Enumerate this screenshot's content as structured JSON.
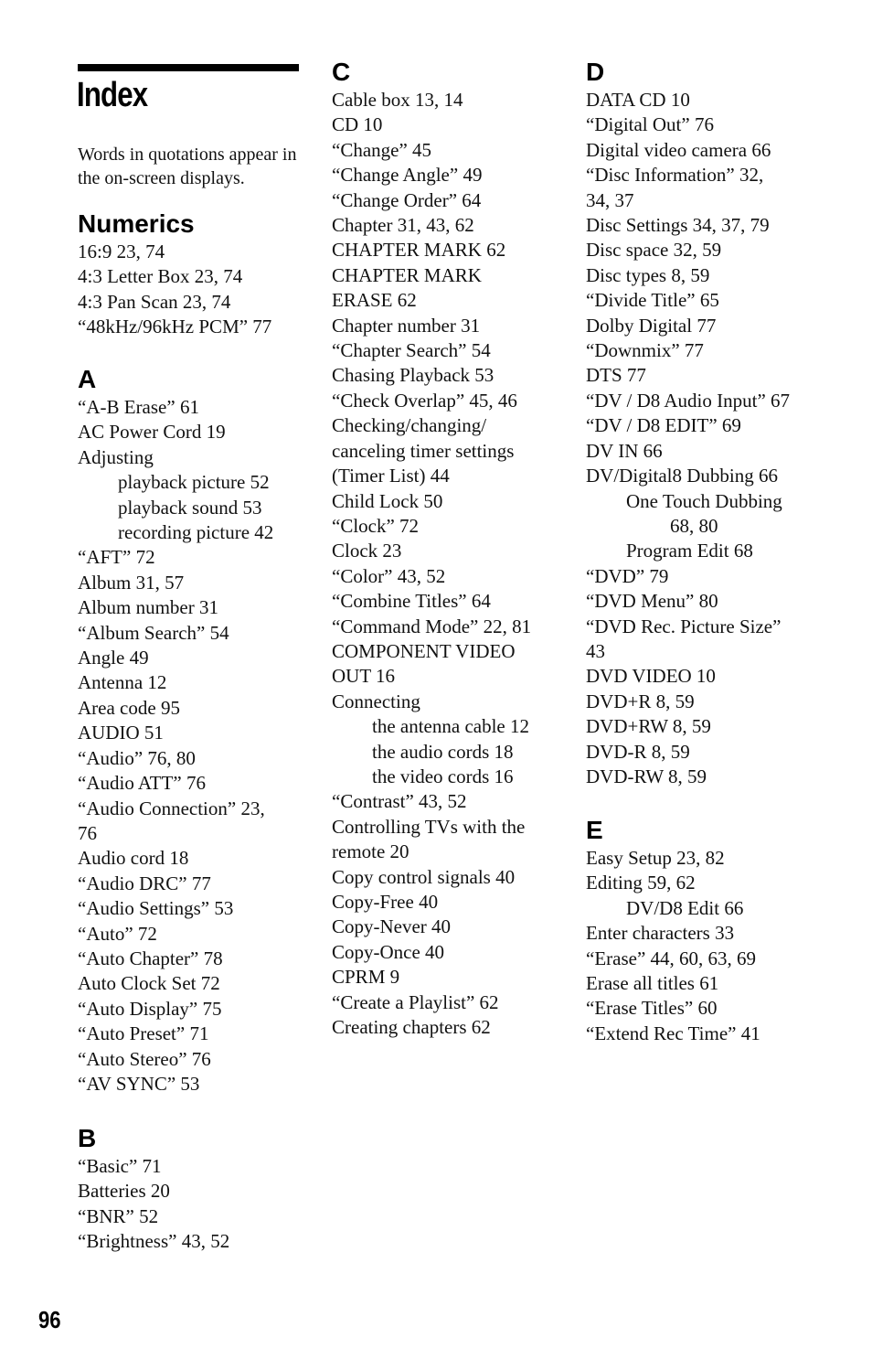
{
  "page": {
    "title": "Index",
    "note": "Words in quotations appear in the on-screen displays.",
    "page_number": "96"
  },
  "sections": {
    "numerics": {
      "heading": "Numerics",
      "entries": [
        {
          "text": "16:9 23, 74",
          "level": 0
        },
        {
          "text": "4:3 Letter Box 23, 74",
          "level": 0
        },
        {
          "text": "4:3 Pan Scan 23, 74",
          "level": 0
        },
        {
          "text": "“48kHz/96kHz PCM” 77",
          "level": 0
        }
      ]
    },
    "a": {
      "heading": "A",
      "entries": [
        {
          "text": "“A-B Erase” 61",
          "level": 0
        },
        {
          "text": "AC Power Cord 19",
          "level": 0
        },
        {
          "text": "Adjusting",
          "level": 0
        },
        {
          "text": "playback picture 52",
          "level": 1
        },
        {
          "text": "playback sound 53",
          "level": 1
        },
        {
          "text": "recording picture 42",
          "level": 1
        },
        {
          "text": "“AFT” 72",
          "level": 0
        },
        {
          "text": "Album 31, 57",
          "level": 0
        },
        {
          "text": "Album number 31",
          "level": 0
        },
        {
          "text": "“Album Search” 54",
          "level": 0
        },
        {
          "text": "Angle 49",
          "level": 0
        },
        {
          "text": "Antenna 12",
          "level": 0
        },
        {
          "text": "Area code 95",
          "level": 0
        },
        {
          "text": "AUDIO 51",
          "level": 0
        },
        {
          "text": "“Audio” 76, 80",
          "level": 0
        },
        {
          "text": "“Audio ATT” 76",
          "level": 0
        },
        {
          "text": "“Audio Connection” 23,",
          "level": 0
        },
        {
          "text": "76",
          "level": 0
        },
        {
          "text": "Audio cord 18",
          "level": 0
        },
        {
          "text": "“Audio DRC” 77",
          "level": 0
        },
        {
          "text": "“Audio Settings” 53",
          "level": 0
        },
        {
          "text": "“Auto” 72",
          "level": 0
        },
        {
          "text": "“Auto Chapter” 78",
          "level": 0
        },
        {
          "text": "Auto Clock Set 72",
          "level": 0
        },
        {
          "text": "“Auto Display” 75",
          "level": 0
        },
        {
          "text": "“Auto Preset” 71",
          "level": 0
        },
        {
          "text": "“Auto Stereo” 76",
          "level": 0
        },
        {
          "text": "“AV SYNC” 53",
          "level": 0
        }
      ]
    },
    "b": {
      "heading": "B",
      "entries": [
        {
          "text": "“Basic” 71",
          "level": 0
        },
        {
          "text": "Batteries 20",
          "level": 0
        },
        {
          "text": "“BNR” 52",
          "level": 0
        },
        {
          "text": "“Brightness” 43, 52",
          "level": 0
        }
      ]
    },
    "c": {
      "heading": "C",
      "entries": [
        {
          "text": "Cable box 13, 14",
          "level": 0
        },
        {
          "text": "CD 10",
          "level": 0
        },
        {
          "text": "“Change” 45",
          "level": 0
        },
        {
          "text": "“Change Angle” 49",
          "level": 0
        },
        {
          "text": "“Change Order” 64",
          "level": 0
        },
        {
          "text": "Chapter 31, 43, 62",
          "level": 0
        },
        {
          "text": "CHAPTER MARK 62",
          "level": 0
        },
        {
          "text": "CHAPTER MARK",
          "level": 0
        },
        {
          "text": "ERASE 62",
          "level": 0
        },
        {
          "text": "Chapter number 31",
          "level": 0
        },
        {
          "text": "“Chapter Search” 54",
          "level": 0
        },
        {
          "text": "Chasing Playback 53",
          "level": 0
        },
        {
          "text": "“Check Overlap” 45, 46",
          "level": 0
        },
        {
          "text": "Checking/changing/",
          "level": 0
        },
        {
          "text": "canceling timer settings",
          "level": 0
        },
        {
          "text": "(Timer List) 44",
          "level": 0
        },
        {
          "text": "Child Lock 50",
          "level": 0
        },
        {
          "text": "“Clock” 72",
          "level": 0
        },
        {
          "text": "Clock 23",
          "level": 0
        },
        {
          "text": "“Color” 43, 52",
          "level": 0
        },
        {
          "text": "“Combine Titles” 64",
          "level": 0
        },
        {
          "text": "“Command Mode” 22, 81",
          "level": 0
        },
        {
          "text": "COMPONENT VIDEO",
          "level": 0
        },
        {
          "text": "OUT 16",
          "level": 0
        },
        {
          "text": "Connecting",
          "level": 0
        },
        {
          "text": "the antenna cable 12",
          "level": 1
        },
        {
          "text": "the audio cords 18",
          "level": 1
        },
        {
          "text": "the video cords 16",
          "level": 1
        },
        {
          "text": "“Contrast” 43, 52",
          "level": 0
        },
        {
          "text": "Controlling TVs with the",
          "level": 0
        },
        {
          "text": "remote 20",
          "level": 0
        },
        {
          "text": "Copy control signals 40",
          "level": 0
        },
        {
          "text": "Copy-Free 40",
          "level": 0
        },
        {
          "text": "Copy-Never 40",
          "level": 0
        },
        {
          "text": "Copy-Once 40",
          "level": 0
        },
        {
          "text": "CPRM 9",
          "level": 0
        },
        {
          "text": "“Create a Playlist” 62",
          "level": 0
        },
        {
          "text": "Creating chapters 62",
          "level": 0
        }
      ]
    },
    "d": {
      "heading": "D",
      "entries": [
        {
          "text": "DATA CD 10",
          "level": 0
        },
        {
          "text": "“Digital Out” 76",
          "level": 0
        },
        {
          "text": "Digital video camera 66",
          "level": 0
        },
        {
          "text": "“Disc Information” 32,",
          "level": 0
        },
        {
          "text": "34, 37",
          "level": 0
        },
        {
          "text": "Disc Settings 34, 37, 79",
          "level": 0
        },
        {
          "text": "Disc space 32, 59",
          "level": 0
        },
        {
          "text": "Disc types 8, 59",
          "level": 0
        },
        {
          "text": "“Divide Title” 65",
          "level": 0
        },
        {
          "text": "Dolby Digital 77",
          "level": 0
        },
        {
          "text": "“Downmix” 77",
          "level": 0
        },
        {
          "text": "DTS 77",
          "level": 0
        },
        {
          "text": "“DV / D8 Audio Input” 67",
          "level": 0
        },
        {
          "text": "“DV / D8 EDIT” 69",
          "level": 0
        },
        {
          "text": "DV IN 66",
          "level": 0
        },
        {
          "text": "DV/Digital8 Dubbing 66",
          "level": 0
        },
        {
          "text": "One Touch Dubbing",
          "level": 1
        },
        {
          "text": "68, 80",
          "level": 2
        },
        {
          "text": "Program Edit 68",
          "level": 1
        },
        {
          "text": "“DVD” 79",
          "level": 0
        },
        {
          "text": "“DVD Menu” 80",
          "level": 0
        },
        {
          "text": "“DVD Rec. Picture Size”",
          "level": 0
        },
        {
          "text": "43",
          "level": 0
        },
        {
          "text": "DVD VIDEO 10",
          "level": 0
        },
        {
          "text": "DVD+R 8, 59",
          "level": 0
        },
        {
          "text": "DVD+RW 8, 59",
          "level": 0
        },
        {
          "text": "DVD-R 8, 59",
          "level": 0
        },
        {
          "text": "DVD-RW 8, 59",
          "level": 0
        }
      ]
    },
    "e": {
      "heading": "E",
      "entries": [
        {
          "text": "Easy Setup 23, 82",
          "level": 0
        },
        {
          "text": "Editing 59, 62",
          "level": 0
        },
        {
          "text": "DV/D8 Edit 66",
          "level": 1
        },
        {
          "text": "Enter characters 33",
          "level": 0
        },
        {
          "text": "“Erase” 44, 60, 63, 69",
          "level": 0
        },
        {
          "text": "Erase all titles 61",
          "level": 0
        },
        {
          "text": "“Erase Titles” 60",
          "level": 0
        },
        {
          "text": "“Extend Rec Time” 41",
          "level": 0
        }
      ]
    }
  }
}
